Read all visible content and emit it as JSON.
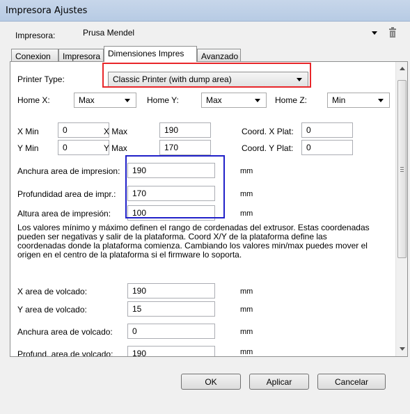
{
  "window": {
    "title": "Impresora Ajustes"
  },
  "printer_row": {
    "label": "Impresora:",
    "value": "Prusa Mendel",
    "trash_icon": "trash-icon"
  },
  "tabs": [
    {
      "label": "Conexion"
    },
    {
      "label": "Impresora"
    },
    {
      "label": "Dimensiones Impres"
    },
    {
      "label": "Avanzado"
    }
  ],
  "form": {
    "printer_type": {
      "label": "Printer Type:",
      "value": "Classic Printer (with dump area)"
    },
    "home_x": {
      "label": "Home X:",
      "value": "Max"
    },
    "home_y": {
      "label": "Home Y:",
      "value": "Max"
    },
    "home_z": {
      "label": "Home Z:",
      "value": "Min"
    },
    "x_min": {
      "label": "X Min",
      "value": "0"
    },
    "x_max": {
      "label": "X Max",
      "value": "190"
    },
    "coord_x_plat": {
      "label": "Coord. X Plat:",
      "value": "0"
    },
    "y_min": {
      "label": "Y Min",
      "value": "0"
    },
    "y_max": {
      "label": "Y Max",
      "value": "170"
    },
    "coord_y_plat": {
      "label": "Coord. Y Plat:",
      "value": "0"
    },
    "print_width": {
      "label": "Anchura area de impresion:",
      "value": "190",
      "unit": "mm"
    },
    "print_depth": {
      "label": "Profundidad area de impr.:",
      "value": "170",
      "unit": "mm"
    },
    "print_height": {
      "label": "Altura area de impresión:",
      "value": "100",
      "unit": "mm"
    },
    "info": [
      "Los valores mínimo y máximo definen el rango de cordenadas del extrusor. Estas coordenadas",
      "pueden ser negativas y salir de la plataforma. Coord X/Y de la plataforma define las",
      "coordenadas donde la plataforma comienza. Cambiando los valores min/max puedes mover el",
      "origen en el centro de la plataforma si el firmware lo soporta."
    ],
    "dump_x": {
      "label": "X area de volcado:",
      "value": "190",
      "unit": "mm"
    },
    "dump_y": {
      "label": "Y area de volcado:",
      "value": "15",
      "unit": "mm"
    },
    "dump_width": {
      "label": "Anchura area de volcado:",
      "value": "0",
      "unit": "mm"
    },
    "dump_depth": {
      "label": "Profund. area de volcado:",
      "value": "190",
      "unit": "mm"
    }
  },
  "buttons": {
    "ok": "OK",
    "apply": "Aplicar",
    "cancel": "Cancelar"
  },
  "colors": {
    "highlight_red": "#e8262a",
    "highlight_blue": "#2020c8",
    "title_bar": "#bfd0e7"
  }
}
